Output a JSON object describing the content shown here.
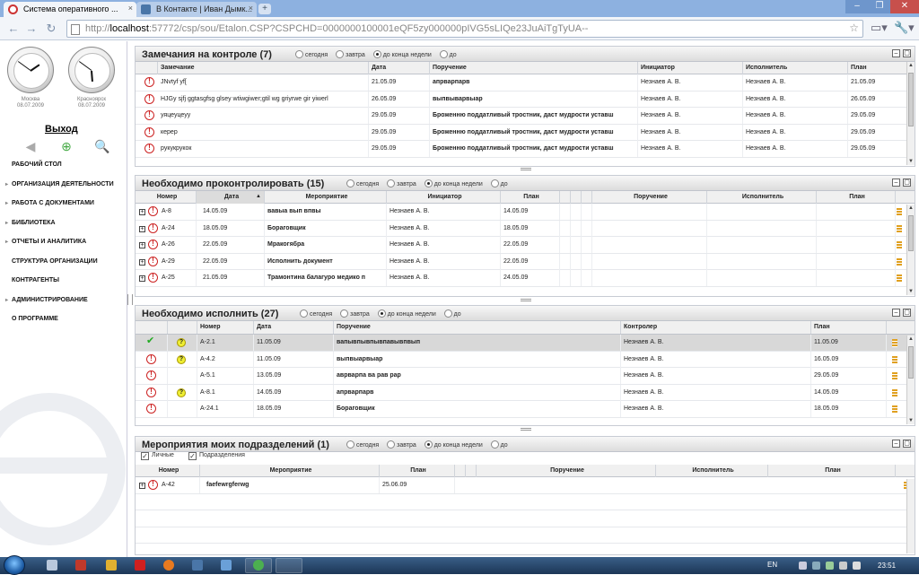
{
  "browser": {
    "tabs": [
      {
        "title": "Система оперативного ...",
        "active": true,
        "close": "×"
      },
      {
        "title": "В Контакте | Иван Дымк...",
        "active": false,
        "close": "×"
      }
    ],
    "new_tab": "+",
    "controls": {
      "min": "–",
      "max": "❐",
      "close": "✕"
    },
    "nav": {
      "back": "←",
      "forward": "→",
      "reload": "↻"
    },
    "url_prefix": "http://",
    "url_host": "localhost",
    "url_rest": ":57772/csp/sou/Etalon.CSP?CSPCHD=0000000100001eQF5zy000000pIVG5sLIQe23JuAiTgTyUA--",
    "star": "☆",
    "page_menu": "▭▾",
    "tools_menu": "🔧▾"
  },
  "sidebar": {
    "clocks": [
      {
        "city": "Москва",
        "date": "08.07.2009",
        "hour": 1.85,
        "minute": 51
      },
      {
        "city": "Красноярск",
        "date": "08.07.2009",
        "hour": 5.85,
        "minute": 51
      }
    ],
    "logout": "Выход",
    "icons": [
      "◀",
      "⊕",
      "🔍"
    ],
    "nav": [
      {
        "label": "РАБОЧИЙ СТОЛ",
        "dot": false
      },
      {
        "label": "ОРГАНИЗАЦИЯ ДЕЯТЕЛЬНОСТИ",
        "dot": true
      },
      {
        "label": "РАБОТА С ДОКУМЕНТАМИ",
        "dot": true
      },
      {
        "label": "БИБЛИОТЕКА",
        "dot": true
      },
      {
        "label": "ОТЧЕТЫ И АНАЛИТИКА",
        "dot": true
      },
      {
        "label": "СТРУКТУРА ОРГАНИЗАЦИИ",
        "dot": false
      },
      {
        "label": "КОНТРАГЕНТЫ",
        "dot": false
      },
      {
        "label": "АДМИНИСТРИРОВАНИЕ",
        "dot": true
      },
      {
        "label": "О ПРОГРАММЕ",
        "dot": false
      }
    ]
  },
  "panel_buttons": {
    "min": "–",
    "max": "▢"
  },
  "filters": {
    "today": "сегодня",
    "tomorrow": "завтра",
    "week": "до конца недели",
    "to": "до"
  },
  "panel1": {
    "title": "Замечания на контроле (7)",
    "columns": [
      "Замечание",
      "Дата",
      "Поручение",
      "Инициатор",
      "Исполнитель",
      "План"
    ],
    "rows": [
      {
        "remark": "JNvtyf yf[",
        "date": "21.05.09",
        "order": "апрварпарв",
        "initiator": "Незнаев А. В.",
        "executor": "Незнаев А. В.",
        "plan": "21.05.09"
      },
      {
        "remark": "HJGy sjfj ggtasgfsg glsey wtiwgiwer;gtil wg griyrwe gir yiwerl",
        "date": "26.05.09",
        "order": "выпвыварвыар",
        "initiator": "Незнаев А. В.",
        "executor": "Незнаев А. В.",
        "plan": "26.05.09"
      },
      {
        "remark": "уяцеуцеуу",
        "date": "29.05.09",
        "order": "Броженню поддатливый тростник, даст мудрости уставш",
        "initiator": "Незнаев А. В.",
        "executor": "Незнаев А. В.",
        "plan": "29.05.09"
      },
      {
        "remark": "керер",
        "date": "29.05.09",
        "order": "Броженню поддатливый тростник, даст мудрости уставш",
        "initiator": "Незнаев А. В.",
        "executor": "Незнаев А. В.",
        "plan": "29.05.09"
      },
      {
        "remark": "рукукрукок",
        "date": "29.05.09",
        "order": "Броженню поддатливый тростник, даст мудрости уставш",
        "initiator": "Незнаев А. В.",
        "executor": "Незнаев А. В.",
        "plan": "29.05.09"
      }
    ]
  },
  "panel2": {
    "title": "Необходимо проконтролировать (15)",
    "columns": [
      "Номер",
      "Дата",
      "Мероприятие",
      "Инициатор",
      "План",
      "Поручение",
      "Исполнитель",
      "План"
    ],
    "sort_indicator": "▲",
    "rows": [
      {
        "num": "А-8",
        "date": "14.05.09",
        "event": "вавыа вып впвы",
        "initiator": "Незнаев А. В.",
        "plan": "14.05.09"
      },
      {
        "num": "А-24",
        "date": "18.05.09",
        "event": "Бораговщик",
        "initiator": "Незнаев А. В.",
        "plan": "18.05.09"
      },
      {
        "num": "А-26",
        "date": "22.05.09",
        "event": "Мракогябра",
        "initiator": "Незнаев А. В.",
        "plan": "22.05.09"
      },
      {
        "num": "А-29",
        "date": "22.05.09",
        "event": "Исполнить документ",
        "initiator": "Незнаев А. В.",
        "plan": "22.05.09"
      },
      {
        "num": "А-25",
        "date": "21.05.09",
        "event": "Трамонтина балагуро медико п",
        "initiator": "Незнаев А. В.",
        "plan": "24.05.09"
      }
    ]
  },
  "panel3": {
    "title": "Необходимо исполнить (27)",
    "columns": [
      "Номер",
      "Дата",
      "Поручение",
      "Контролер",
      "План"
    ],
    "rows": [
      {
        "status": "done",
        "q": true,
        "num": "А-2.1",
        "date": "11.05.09",
        "order": "вапывпывпывпавывпвып",
        "controller": "Незнаев А. В.",
        "plan": "11.05.09",
        "selected": true
      },
      {
        "status": "alert",
        "q": true,
        "num": "А-4.2",
        "date": "11.05.09",
        "order": "выпвыарвыар",
        "controller": "Незнаев А. В.",
        "plan": "16.05.09",
        "selected": false
      },
      {
        "status": "alert",
        "q": false,
        "num": "А-5.1",
        "date": "13.05.09",
        "order": "аврварпа ва рав рар",
        "controller": "Незнаев А. В.",
        "plan": "29.05.09",
        "selected": false
      },
      {
        "status": "alert",
        "q": true,
        "num": "А-8.1",
        "date": "14.05.09",
        "order": "апрварпарв",
        "controller": "Незнаев А. В.",
        "plan": "14.05.09",
        "selected": false
      },
      {
        "status": "alert",
        "q": false,
        "num": "А-24.1",
        "date": "18.05.09",
        "order": "Бораговщик",
        "controller": "Незнаев А. В.",
        "plan": "18.05.09",
        "selected": false
      }
    ]
  },
  "panel4": {
    "title": "Мероприятия моих подразделений (1)",
    "check_personal": "Личные",
    "check_units": "Подразделения",
    "checkmark": "✓",
    "columns": [
      "Номер",
      "Мероприятие",
      "План",
      "Поручение",
      "Исполнитель",
      "План"
    ],
    "rows": [
      {
        "num": "А-42",
        "event": "faefewrgferwg",
        "plan": "25.06.09"
      }
    ]
  },
  "taskbar": {
    "lang": "EN",
    "time": "23:51"
  },
  "colors": {
    "chrome_blue": "#8db1e0",
    "alert_red": "#cc2222",
    "check_green": "#22aa22",
    "header_bg": "#dcdcdc"
  }
}
